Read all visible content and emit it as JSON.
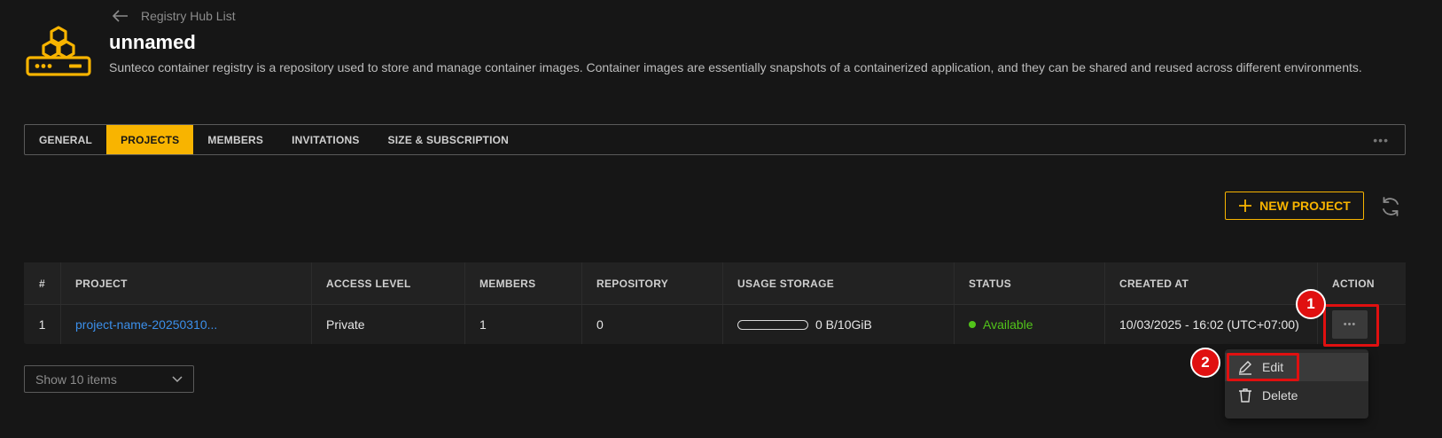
{
  "back_label": "Registry Hub List",
  "title": "unnamed",
  "description": "Sunteco container registry is a repository used to store and manage container images. Container images are essentially snapshots of a containerized application, and they can be shared and reused across different environments.",
  "tabs": [
    {
      "label": "GENERAL",
      "active": false
    },
    {
      "label": "PROJECTS",
      "active": true
    },
    {
      "label": "MEMBERS",
      "active": false
    },
    {
      "label": "INVITATIONS",
      "active": false
    },
    {
      "label": "SIZE & SUBSCRIPTION",
      "active": false
    }
  ],
  "tabs_more": "•••",
  "new_project_label": "NEW PROJECT",
  "table": {
    "headers": [
      "#",
      "PROJECT",
      "ACCESS LEVEL",
      "MEMBERS",
      "REPOSITORY",
      "USAGE STORAGE",
      "STATUS",
      "CREATED AT",
      "ACTION"
    ],
    "rows": [
      {
        "index": "1",
        "project": "project-name-20250310...",
        "access_level": "Private",
        "members": "1",
        "repository": "0",
        "usage_storage": "0 B/10GiB",
        "usage_fraction": 0,
        "status": "Available",
        "created_at": "10/03/2025 - 16:02 (UTC+07:00)",
        "action": "•••"
      }
    ]
  },
  "page_size_select": "Show 10 items",
  "context_menu": {
    "items": [
      {
        "label": "Edit",
        "icon": "pencil-icon"
      },
      {
        "label": "Delete",
        "icon": "trash-icon"
      }
    ]
  },
  "annotations": [
    "1",
    "2"
  ],
  "colors": {
    "accent": "#f8b400",
    "link": "#3b8fea",
    "status_available": "#52c41a",
    "annotation_red": "#e01010",
    "background": "#161616"
  }
}
